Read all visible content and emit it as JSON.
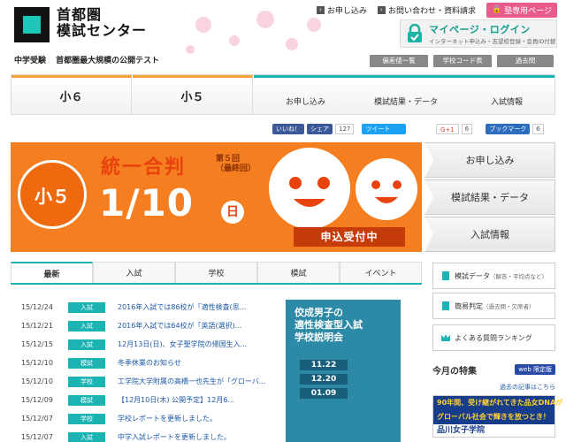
{
  "header": {
    "logo_line1": "首都圏",
    "logo_line2": "模試センター",
    "tagline1": "中学受験",
    "tagline2": "首都圏最大規模の公開テスト",
    "top_links": [
      "お申し込み",
      "お問い合わせ・資料請求"
    ],
    "group_page": "塾専用ページ",
    "mypage_title": "マイページ・ログイン",
    "mypage_sub": "インターネット申込み・志望校登録・会員ID付替",
    "mini_buttons": [
      "偏差値一覧",
      "学校コード表",
      "過去問"
    ]
  },
  "nav": {
    "grades": [
      "小６",
      "小５"
    ],
    "sub": [
      "お申し込み",
      "模試結果・データ",
      "入試情報"
    ]
  },
  "social": {
    "like": "いいね！",
    "share": "シェア",
    "share_count": "127",
    "tweet": "ツイート",
    "gplus": "G+1",
    "gplus_count": "6",
    "bookmark": "ブックマーク",
    "bookmark_count": "6"
  },
  "banner": {
    "grade": "小５",
    "title": "統一合判",
    "sub1": "第５回",
    "sub2": "（最終回）",
    "date": "1/10",
    "day": "日",
    "deadline": "申込受付中"
  },
  "side_menu": [
    "お申し込み",
    "模試結果・データ",
    "入試情報"
  ],
  "tabs": [
    "最新",
    "入試",
    "学校",
    "模試",
    "イベント"
  ],
  "news": [
    {
      "date": "15/12/24",
      "tag": "入試",
      "title": "2016年入試では86校が「適性検査(思..."
    },
    {
      "date": "15/12/21",
      "tag": "入試",
      "title": "2016年入試では64校が「英語(選択)..."
    },
    {
      "date": "15/12/15",
      "tag": "入試",
      "title": "12月13日(日)、女子聖学院の帰国生入..."
    },
    {
      "date": "15/12/10",
      "tag": "模試",
      "title": "冬季休業のお知らせ"
    },
    {
      "date": "15/12/10",
      "tag": "学校",
      "title": "工学院大学附属の高橋一也先生が「グローバ..."
    },
    {
      "date": "15/12/09",
      "tag": "模試",
      "title": "【12月10日(木) 公開予定】12月6..."
    },
    {
      "date": "15/12/07",
      "tag": "学校",
      "title": "学校レポートを更新しました。"
    },
    {
      "date": "15/12/07",
      "tag": "入試",
      "title": "中学入試レポートを更新しました。"
    }
  ],
  "promo": {
    "title1": "佼成男子の",
    "title2": "適性検査型入試",
    "title3": "学校説明会",
    "dates": [
      "11.22",
      "12.20",
      "01.09"
    ]
  },
  "right": {
    "btn1": "模試データ",
    "btn1_sub": "（解答・平均点など）",
    "btn2": "簡易判定",
    "btn2_sub": "（過去問・欠席者）",
    "btn3": "よくある質問ランキング"
  },
  "feature": {
    "title": "今月の特集",
    "badge": "web 限定版",
    "past": "過去の記事はこちら",
    "img_line1": "90年間、受け継がれてきた品女DNAが",
    "img_line2": "グローバル社会で輝きを放つとき！",
    "school": "品川女子学院"
  }
}
